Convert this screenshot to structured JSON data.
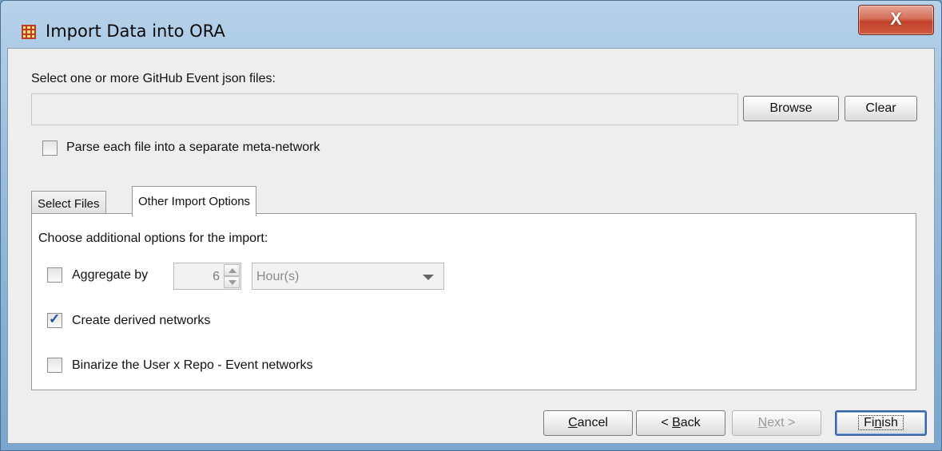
{
  "window": {
    "title": "Import Data into ORA",
    "close_label": "X"
  },
  "files": {
    "prompt": "Select one or more GitHub Event json files:",
    "path_value": "",
    "browse_label": "Browse",
    "clear_label": "Clear"
  },
  "parse_separate": {
    "label": "Parse each file into a separate meta-network",
    "checked": false
  },
  "tabs": [
    {
      "label": "Select Files",
      "active": false
    },
    {
      "label": "Other Import Options",
      "active": true
    }
  ],
  "options": {
    "heading": "Choose additional options for the import:",
    "aggregate": {
      "label": "Aggregate by",
      "checked": false,
      "amount": "6",
      "unit": "Hour(s)"
    },
    "derived": {
      "label": "Create derived networks",
      "checked": true
    },
    "binarize": {
      "label": "Binarize the User x Repo - Event networks",
      "checked": false
    }
  },
  "footer": {
    "cancel": {
      "mnemonic": "C",
      "rest": "ancel"
    },
    "back": {
      "pre": "< ",
      "mnemonic": "B",
      "rest": "ack"
    },
    "next": {
      "mnemonic": "N",
      "rest": "ext >"
    },
    "finish": {
      "pre": "Fi",
      "mnemonic": "n",
      "rest": "ish"
    }
  },
  "colors": {
    "title_bar": "#9cc0e0",
    "close_button": "#c2422a",
    "check_mark": "#1c4fa0",
    "panel": "#eeeeee"
  },
  "icons": [
    "ora-app-icon",
    "close-icon",
    "check-icon",
    "spinner-up-icon",
    "spinner-down-icon",
    "dropdown-arrow-icon"
  ]
}
